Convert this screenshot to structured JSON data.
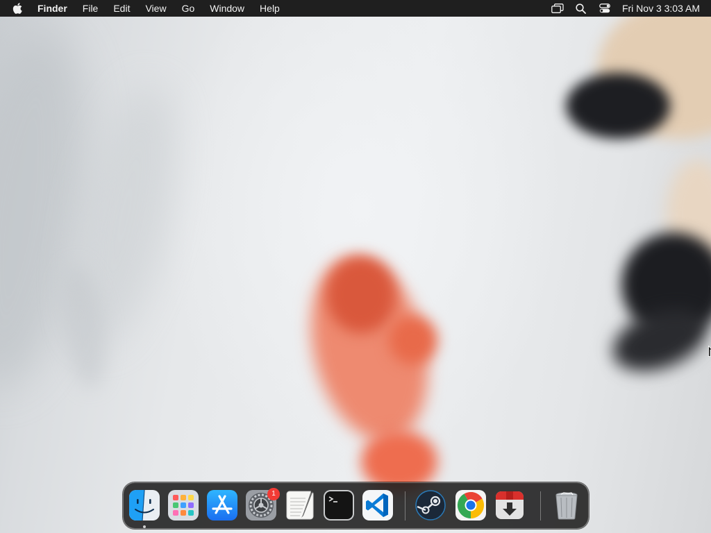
{
  "menubar": {
    "apple_icon": "apple-logo-icon",
    "app_name": "Finder",
    "menus": [
      "File",
      "Edit",
      "View",
      "Go",
      "Window",
      "Help"
    ],
    "status_icons": [
      "screen-mirroring-icon",
      "spotlight-search-icon",
      "control-center-icon"
    ],
    "clock": "Fri Nov 3  3:03 AM"
  },
  "dock": {
    "apps": [
      {
        "name": "Finder",
        "icon": "finder-icon",
        "running": true
      },
      {
        "name": "Launchpad",
        "icon": "launchpad-icon",
        "running": false
      },
      {
        "name": "App Store",
        "icon": "app-store-icon",
        "running": false
      },
      {
        "name": "System Settings",
        "icon": "system-settings-icon",
        "running": false,
        "badge": "1"
      },
      {
        "name": "TextEdit",
        "icon": "textedit-icon",
        "running": false
      },
      {
        "name": "Terminal",
        "icon": "terminal-icon",
        "running": false
      },
      {
        "name": "Visual Studio Code",
        "icon": "vscode-icon",
        "running": false
      },
      {
        "name": "Steam",
        "icon": "steam-icon",
        "running": false
      },
      {
        "name": "Google Chrome",
        "icon": "chrome-icon",
        "running": false
      },
      {
        "name": "Transmit",
        "icon": "downloader-icon",
        "running": false
      },
      {
        "name": "Trash",
        "icon": "trash-icon",
        "running": false
      }
    ]
  },
  "colors": {
    "menubar_bg": "#1f1f1f",
    "badge": "#f23b35",
    "vscode_blue": "#0a7bd6",
    "appstore_blue": "#1d8cf8"
  }
}
